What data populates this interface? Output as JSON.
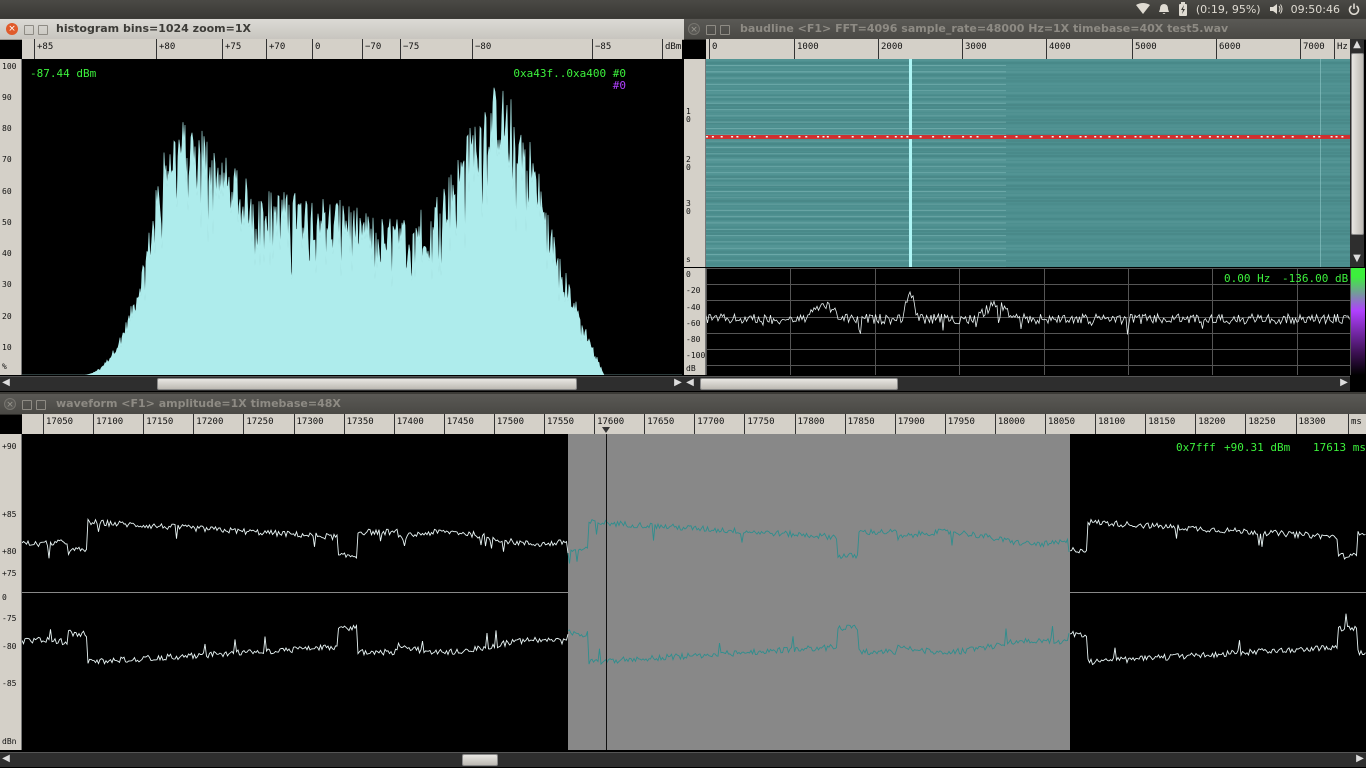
{
  "colors": {
    "hud_green": "#3cf03c",
    "hud_purple": "#b040ff",
    "histogram_fill": "#aeecec",
    "wave_line": "#e8f4f4",
    "wave_line_selected": "#2e8e8e",
    "selection_bg": "#888888",
    "spectrogram_bg": "#4d8f8f",
    "spectrogram_marker": "#d03030"
  },
  "top_panel": {
    "battery": "(0:19, 95%)",
    "clock": "09:50:46",
    "icons": [
      "wifi-icon",
      "bell-icon",
      "battery-icon",
      "speaker-icon",
      "power-icon"
    ]
  },
  "histogram": {
    "title": "histogram  bins=1024 zoom=1X",
    "ruler_labels": [
      "+85",
      "+80",
      "+75",
      "+70",
      "0",
      "−70",
      "−75",
      "−80",
      "−85",
      "dBm"
    ],
    "y_labels": [
      "100",
      "90",
      "80",
      "70",
      "60",
      "50",
      "40",
      "30",
      "20",
      "10",
      "%"
    ],
    "readout_left": "-87.44 dBm",
    "readout_right_line1": "0xa43f..0xa400 #0",
    "readout_right_line2": "#0"
  },
  "baudline": {
    "title": "baudline  <F1> FFT=4096 sample_rate=48000 Hz=1X timebase=40X  test5.wav",
    "ruler_labels": [
      "0",
      "1000",
      "2000",
      "3000",
      "4000",
      "5000",
      "6000",
      "7000",
      "Hz"
    ],
    "spectro_side_labels": [
      "1",
      "0",
      "2",
      "0",
      "3",
      "0",
      "s"
    ],
    "spectrum_y_labels": [
      "0",
      "-20",
      "-40",
      "-60",
      "-80",
      "-100",
      "dB"
    ],
    "readout_hz": "0.00 Hz",
    "readout_db": "-136.00 dB"
  },
  "waveform": {
    "title": "waveform  <F1> amplitude=1X timebase=48X",
    "ruler_labels": [
      "17050",
      "17100",
      "17150",
      "17200",
      "17250",
      "17300",
      "17350",
      "17400",
      "17450",
      "17500",
      "17550",
      "17600",
      "17650",
      "17700",
      "17750",
      "17800",
      "17850",
      "17900",
      "17950",
      "18000",
      "18050",
      "18100",
      "18150",
      "18200",
      "18250",
      "18300",
      "ms"
    ],
    "y_labels": [
      "+90",
      "+85",
      "+80",
      "+75",
      "0",
      "-75",
      "-80",
      "-85",
      "dBn"
    ],
    "readout_hex": "0x7fff",
    "readout_dbm": "+90.31 dBm",
    "readout_ms": "17613 ms"
  }
}
